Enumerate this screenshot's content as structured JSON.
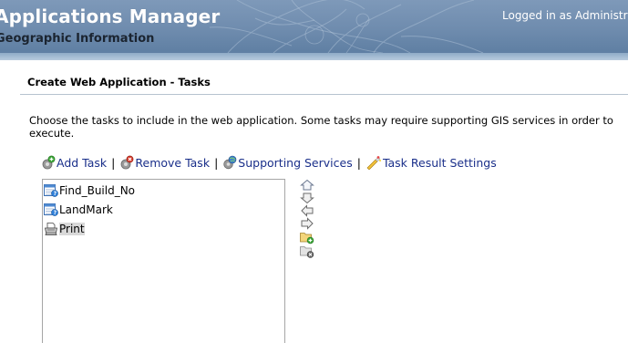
{
  "header": {
    "app_title": "Applications Manager",
    "app_subtitle": "Geographic Information",
    "login_status": "Logged in as Administrator"
  },
  "page": {
    "section_title": "Create Web Application - Tasks",
    "instructions": "Choose the tasks to include in the web application. Some tasks may require supporting GIS services in order to execute."
  },
  "toolbar": {
    "add_task": "Add Task",
    "remove_task": "Remove Task",
    "supporting_services": "Supporting Services",
    "task_result_settings": "Task Result Settings",
    "separator": "|"
  },
  "tasks": [
    {
      "label": "Find_Build_No",
      "icon": "query-task-icon",
      "selected": false
    },
    {
      "label": "LandMark",
      "icon": "query-task-icon",
      "selected": false
    },
    {
      "label": "Print",
      "icon": "printer-icon",
      "selected": true
    }
  ],
  "controls": [
    "move-up",
    "move-down",
    "move-first",
    "move-last",
    "add-group",
    "remove-group"
  ],
  "colors": {
    "header_bg": "#6f8cae",
    "link_color": "#1a2f8a",
    "selection_bg": "#d9d9d9"
  }
}
